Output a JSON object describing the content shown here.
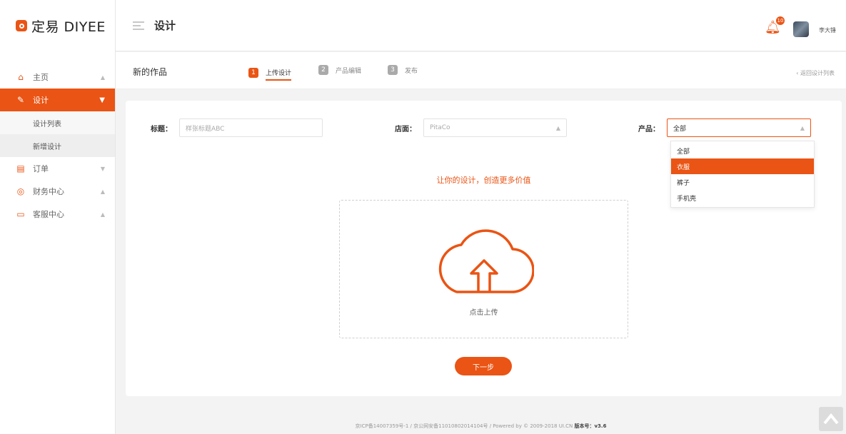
{
  "brand": {
    "name": "定易 DIYEE"
  },
  "sidebar": {
    "items": [
      {
        "label": "主页",
        "icon": "home-icon"
      },
      {
        "label": "设计",
        "icon": "pencil-icon"
      },
      {
        "label": "订单",
        "icon": "document-icon"
      },
      {
        "label": "财务中心",
        "icon": "coin-icon"
      },
      {
        "label": "客服中心",
        "icon": "chat-icon"
      }
    ],
    "sub_items": [
      {
        "label": "设计列表"
      },
      {
        "label": "新增设计"
      }
    ]
  },
  "topbar": {
    "title": "设计",
    "notification_count": "10",
    "username": "李大锤"
  },
  "subhead": {
    "page_title": "新的作品",
    "steps": [
      {
        "num": "1",
        "label": "上传设计"
      },
      {
        "num": "2",
        "label": "产品编辑"
      },
      {
        "num": "3",
        "label": "发布"
      }
    ],
    "back_label": "返回设计列表"
  },
  "form": {
    "title_label": "标题：",
    "title_placeholder": "样张标题ABC",
    "shop_label": "店面：",
    "shop_value": "PitaCo",
    "product_label": "产品：",
    "product_value": "全部",
    "product_options": [
      "全部",
      "衣服",
      "裤子",
      "手机壳"
    ],
    "highlighted_option": "衣服"
  },
  "upload": {
    "slogan": "让你的设计，创造更多价值",
    "label": "点击上传"
  },
  "next_button": "下一步",
  "footer": {
    "text": "京ICP备14007359号-1 / 京公网安备11010802014104号 / Powered by © 2009-2018 UI.CN",
    "version_label": "版本号：v3.6"
  },
  "colors": {
    "accent": "#ea5414"
  }
}
